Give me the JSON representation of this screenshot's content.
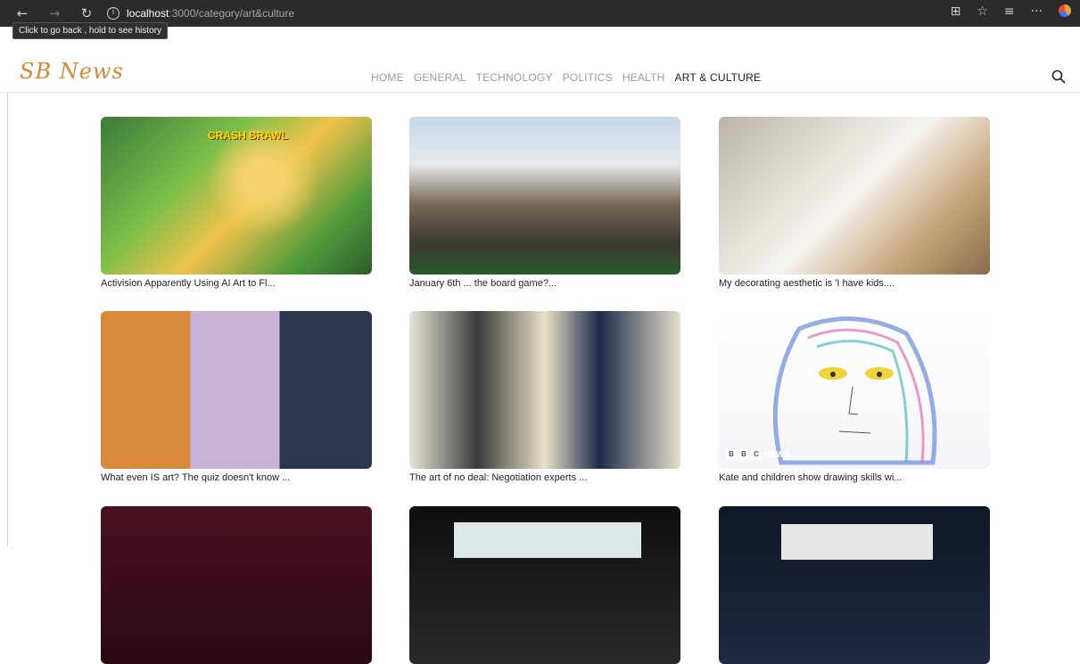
{
  "browser": {
    "back": "←",
    "forward": "→",
    "reload": "↻",
    "url_host": "localhost",
    "url_path": ":3000/category/art&culture",
    "tooltip": "Click to go back , hold to see history"
  },
  "site": {
    "logo": "SB News",
    "nav": [
      {
        "label": "HOME"
      },
      {
        "label": "GENERAL"
      },
      {
        "label": "TECHNOLOGY"
      },
      {
        "label": "POLITICS"
      },
      {
        "label": "HEALTH"
      },
      {
        "label": "ART & CULTURE"
      }
    ]
  },
  "articles": [
    {
      "caption": "Activision Apparently Using AI Art to Fl...",
      "thumb_text": "CRASH BRAWL"
    },
    {
      "caption": "January 6th ... the board game?...",
      "thumb_text": ""
    },
    {
      "caption": "My decorating aesthetic is 'I have kids....",
      "thumb_text": ""
    },
    {
      "caption": "What even IS art? The quiz doesn't know ...",
      "thumb_text": ""
    },
    {
      "caption": "The art of no deal: Negotiation experts ...",
      "thumb_text": ""
    },
    {
      "caption": "Kate and children show drawing skills wi...",
      "thumb_text": "NEWS"
    },
    {
      "caption": "",
      "thumb_text": ""
    },
    {
      "caption": "",
      "thumb_text": ""
    },
    {
      "caption": "",
      "thumb_text": ""
    }
  ]
}
